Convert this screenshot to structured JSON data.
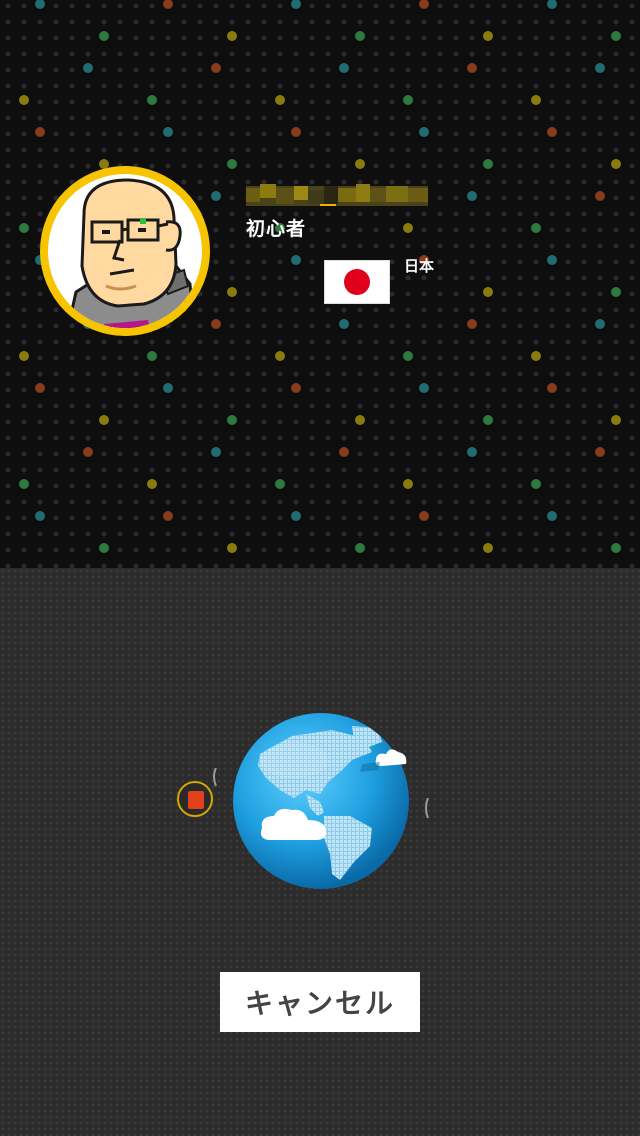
{
  "profile": {
    "rank": "初心者",
    "country": "日本",
    "flag": "japan-flag-icon",
    "avatar": "pixel-bald-man-glasses-avatar",
    "ring_color": "#f6c400"
  },
  "status": {
    "animation": "spinning-globe-icon",
    "opponent_marker": "red-robot-icon"
  },
  "actions": {
    "cancel_label": "キャンセル"
  },
  "colors": {
    "dot_palette": [
      "#1e6b74",
      "#2f7a3f",
      "#8a3a1e",
      "#8a7a12"
    ],
    "ocean": "#2aa8e6",
    "flag_red": "#e0001b"
  }
}
